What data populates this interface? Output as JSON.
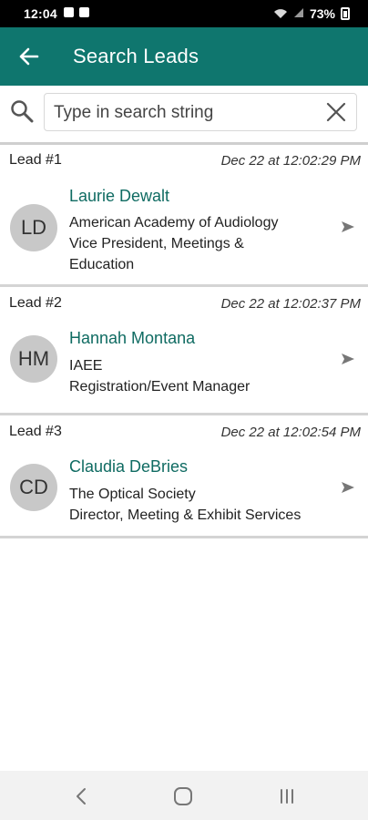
{
  "status_bar": {
    "time": "12:04",
    "battery": "73%"
  },
  "app_bar": {
    "title": "Search Leads",
    "back_icon": "back-arrow-icon"
  },
  "search": {
    "placeholder": "Type in search string",
    "value": "",
    "search_icon": "search-icon",
    "clear_icon": "close-icon"
  },
  "leads": [
    {
      "number": "Lead #1",
      "timestamp": "Dec 22 at 12:02:29 PM",
      "initials": "LD",
      "name": "Laurie Dewalt",
      "organization": "American Academy of Audiology",
      "title_line1": "Vice President, Meetings &",
      "title_line2": "Education"
    },
    {
      "number": "Lead #2",
      "timestamp": "Dec 22 at 12:02:37 PM",
      "initials": "HM",
      "name": "Hannah Montana",
      "organization": "IAEE",
      "title_line1": "Registration/Event Manager",
      "title_line2": ""
    },
    {
      "number": "Lead #3",
      "timestamp": "Dec 22 at 12:02:54 PM",
      "initials": "CD",
      "name": "Claudia DeBries",
      "organization": "The Optical Society",
      "title_line1": "Director, Meeting & Exhibit Services",
      "title_line2": ""
    }
  ],
  "colors": {
    "accent": "#0f766e",
    "name_text": "#0f6b62",
    "avatar_bg": "#c8c8c8"
  }
}
